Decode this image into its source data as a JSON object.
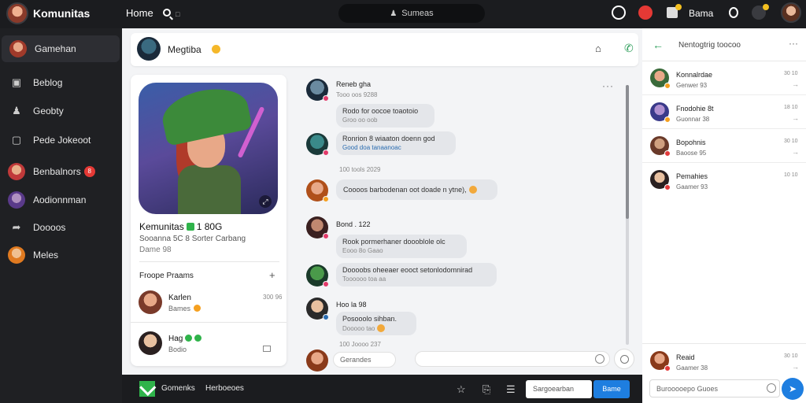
{
  "topbar": {
    "brand": "Komunitas",
    "home": "Home",
    "search_label": "",
    "center_search": "Sumeas",
    "user_label": "Bama"
  },
  "sidebar": {
    "items": [
      {
        "label": "Gamehan",
        "icon": "avatar"
      },
      {
        "label": "Beblog",
        "icon": "home-icon"
      },
      {
        "label": "Geobty",
        "icon": "person-icon"
      },
      {
        "label": "Pede Jokeoot",
        "icon": "monitor-icon"
      },
      {
        "label": "Benbalnors",
        "icon": "avatar",
        "badge": "8"
      },
      {
        "label": "Aodionnman",
        "icon": "avatar"
      },
      {
        "label": "Doooos",
        "icon": "arrow-icon"
      },
      {
        "label": "Meles",
        "icon": "avatar"
      }
    ]
  },
  "chat_header": {
    "name": "Megtiba"
  },
  "profile_card": {
    "title": "Kemunitas",
    "title_num": "1 80G",
    "subtitle": "Sooanna 5C 8 Sorter Carbang",
    "sub2": "Dame 98",
    "friends_label": "Froope Praams",
    "friends": [
      {
        "name": "Karlen",
        "sub": "Bames",
        "time": "300 96"
      },
      {
        "name": "Hag",
        "sub": "Bodio",
        "time": ""
      }
    ]
  },
  "messages": [
    {
      "name": "Reneb gha",
      "time": "Tooo oos 9288"
    },
    {
      "text": "Rodo for oocoe toaotoio",
      "l2": "Groo oo oob"
    },
    {
      "text": "Ronrion 8 wiaaton doenn god",
      "l2": "Good doa tanaanoac",
      "blue": true
    },
    {
      "stamp": "100 tools 2029"
    },
    {
      "text": "Coooos barbodenan oot doade n ytne),"
    },
    {
      "name": "Bond . 122"
    },
    {
      "text": "Rook pormerhaner doooblole olc",
      "l2": "Eooo 8o Gaao"
    },
    {
      "text": "Doooobs oheeaer eooct setonlodomnirad",
      "l2": "Toooooo toa aa"
    },
    {
      "name": "Hoo la 98"
    },
    {
      "text": "Posooolo sihban.",
      "l2": "Dooooo tao"
    },
    {
      "stamp": "100 Joooo 237"
    }
  ],
  "composer": {
    "placeholder": "Gerandes"
  },
  "bottombar": {
    "label1": "Gomenks",
    "label2": "Herboeoes",
    "input": "Sargoearban",
    "button": "Bame"
  },
  "rpanel": {
    "title": "Nentogtrig toocoo",
    "items": [
      {
        "name": "Konnalrdae",
        "sub": "Genwer 93",
        "time": "30 10"
      },
      {
        "name": "Fnodohie 8t",
        "sub": "Guonnar 38",
        "time": "18 10"
      },
      {
        "name": "Bopohnis",
        "sub": "Baoose 95",
        "time": "30 10"
      },
      {
        "name": "Pemahies",
        "sub": "Gaamer 93",
        "time": "10 10"
      }
    ],
    "bottom_item": {
      "name": "Reaid",
      "sub": "Gaamer 38",
      "time": "30 10"
    },
    "input": "Burooooepo Guoes"
  },
  "colors": {
    "accent_blue": "#1e7ee0",
    "accent_green": "#2e9e5b",
    "badge_red": "#e53935",
    "dark_bg": "#1f2023"
  }
}
